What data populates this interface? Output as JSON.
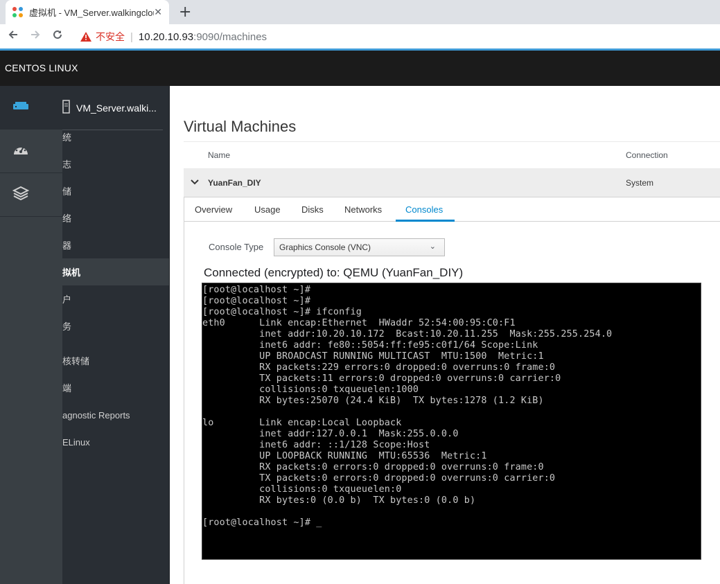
{
  "browser": {
    "tab_title": "虚拟机 - VM_Server.walkingcloud",
    "new_tab": "+",
    "close": "✕",
    "insecure_label": "不安全",
    "url_host": "10.20.10.93",
    "url_rest": ":9090/machines"
  },
  "masthead": {
    "brand": "CENTOS LINUX"
  },
  "rail": {
    "items": [
      {
        "icon": "server-icon"
      },
      {
        "icon": "dashboard-icon"
      },
      {
        "icon": "layers-icon"
      }
    ]
  },
  "hostbar": {
    "host": "VM_Server.walki...",
    "menu": [
      "统",
      "志",
      "储",
      "络",
      "器",
      "拟机",
      "户",
      "务",
      "核转储",
      "端",
      "agnostic Reports",
      "ELinux"
    ],
    "active_index": 5
  },
  "main": {
    "title": "Virtual Machines",
    "col_name": "Name",
    "col_connection": "Connection",
    "vm": {
      "name": "YuanFan_DIY",
      "connection": "System"
    },
    "tabs": [
      "Overview",
      "Usage",
      "Disks",
      "Networks",
      "Consoles"
    ],
    "active_tab": "Consoles",
    "console_type_label": "Console Type",
    "console_type_value": "Graphics Console (VNC)",
    "connected_text": "Connected (encrypted) to: QEMU (YuanFan_DIY)"
  },
  "terminal": {
    "lines": [
      "[root@localhost ~]#",
      "[root@localhost ~]#",
      "[root@localhost ~]# ifconfig",
      "eth0      Link encap:Ethernet  HWaddr 52:54:00:95:C0:F1",
      "          inet addr:10.20.10.172  Bcast:10.20.11.255  Mask:255.255.254.0",
      "          inet6 addr: fe80::5054:ff:fe95:c0f1/64 Scope:Link",
      "          UP BROADCAST RUNNING MULTICAST  MTU:1500  Metric:1",
      "          RX packets:229 errors:0 dropped:0 overruns:0 frame:0",
      "          TX packets:11 errors:0 dropped:0 overruns:0 carrier:0",
      "          collisions:0 txqueuelen:1000",
      "          RX bytes:25070 (24.4 KiB)  TX bytes:1278 (1.2 KiB)",
      "",
      "lo        Link encap:Local Loopback",
      "          inet addr:127.0.0.1  Mask:255.0.0.0",
      "          inet6 addr: ::1/128 Scope:Host",
      "          UP LOOPBACK RUNNING  MTU:65536  Metric:1",
      "          RX packets:0 errors:0 dropped:0 overruns:0 frame:0",
      "          TX packets:0 errors:0 dropped:0 overruns:0 carrier:0",
      "          collisions:0 txqueuelen:0",
      "          RX bytes:0 (0.0 b)  TX bytes:0 (0.0 b)",
      "",
      "[root@localhost ~]# _"
    ]
  },
  "colors": {
    "accent": "#0088ce",
    "masthead": "#1b1b1b",
    "rail": "#393f44",
    "hostbar": "#292e34",
    "insecure": "#d93025"
  }
}
